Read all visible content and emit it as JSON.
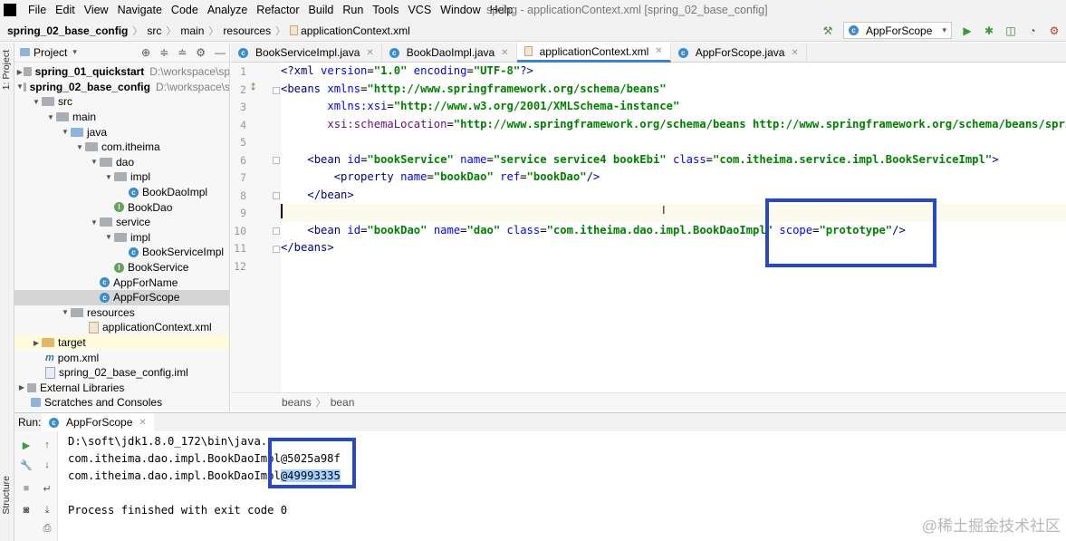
{
  "menubar": {
    "items": [
      "File",
      "Edit",
      "View",
      "Navigate",
      "Code",
      "Analyze",
      "Refactor",
      "Build",
      "Run",
      "Tools",
      "VCS",
      "Window",
      "Help"
    ],
    "window_title": "spring - applicationContext.xml [spring_02_base_config]"
  },
  "navbar": {
    "crumbs": [
      "spring_02_base_config",
      "src",
      "main",
      "resources",
      "applicationContext.xml"
    ],
    "run_config": "AppForScope"
  },
  "left_strip": {
    "project_label": "1: Project",
    "structure_label": "Structure"
  },
  "project": {
    "title": "Project",
    "tree": [
      {
        "label": "spring_01_quickstart",
        "path": "D:\\workspace\\sp"
      },
      {
        "label": "spring_02_base_config",
        "path": "D:\\workspace\\s"
      },
      {
        "label": "src"
      },
      {
        "label": "main"
      },
      {
        "label": "java"
      },
      {
        "label": "com.itheima"
      },
      {
        "label": "dao"
      },
      {
        "label": "impl"
      },
      {
        "label": "BookDaoImpl"
      },
      {
        "label": "BookDao"
      },
      {
        "label": "service"
      },
      {
        "label": "impl"
      },
      {
        "label": "BookServiceImpl"
      },
      {
        "label": "BookService"
      },
      {
        "label": "AppForName"
      },
      {
        "label": "AppForScope"
      },
      {
        "label": "resources"
      },
      {
        "label": "applicationContext.xml"
      },
      {
        "label": "target"
      },
      {
        "label": "pom.xml"
      },
      {
        "label": "spring_02_base_config.iml"
      },
      {
        "label": "External Libraries"
      },
      {
        "label": "Scratches and Consoles"
      }
    ]
  },
  "editor": {
    "tabs": [
      "BookServiceImpl.java",
      "BookDaoImpl.java",
      "applicationContext.xml",
      "AppForScope.java"
    ],
    "active_tab": "applicationContext.xml",
    "line_numbers": [
      "1",
      "2",
      "3",
      "4",
      "5",
      "6",
      "7",
      "8",
      "9",
      "10",
      "11",
      "12"
    ],
    "code": {
      "l1": [
        "<?xml ",
        "version",
        "=",
        "\"1.0\"",
        " ",
        "encoding",
        "=",
        "\"UTF-8\"",
        "?>"
      ],
      "l2": [
        "<beans ",
        "xmlns",
        "=",
        "\"http://www.springframework.org/schema/beans\""
      ],
      "l3": [
        "       ",
        "xmlns:xsi",
        "=",
        "\"http://www.w3.org/2001/XMLSchema-instance\""
      ],
      "l4": [
        "       ",
        "xsi:schemaLocation",
        "=",
        "\"http://www.springframework.org/schema/beans http://www.springframework.org/schema/beans/spri"
      ],
      "l6": [
        "    ",
        "<bean ",
        "id",
        "=",
        "\"bookService\"",
        " ",
        "name",
        "=",
        "\"service service4 bookEbi\"",
        " ",
        "class",
        "=",
        "\"com.itheima.service.impl.BookServiceImpl\"",
        ">"
      ],
      "l7": [
        "        ",
        "<property ",
        "name",
        "=",
        "\"bookDao\"",
        " ",
        "ref",
        "=",
        "\"bookDao\"",
        "/>"
      ],
      "l8": [
        "    ",
        "</bean>"
      ],
      "l10": [
        "    ",
        "<bean ",
        "id",
        "=",
        "\"bookDao\"",
        " ",
        "name",
        "=",
        "\"dao\"",
        " ",
        "class",
        "=",
        "\"com.itheima.dao.impl.BookDaoImpl\"",
        " ",
        "scope",
        "=",
        "\"prototype\"",
        "/>"
      ],
      "l11": [
        "</beans>"
      ]
    },
    "breadcrumb": [
      "beans",
      "bean"
    ]
  },
  "run": {
    "label": "Run:",
    "tab": "AppForScope",
    "console": {
      "line1": "D:\\soft\\jdk1.8.0_172\\bin\\java.",
      "line2_prefix": "com.itheima.dao.impl.BookDaoImpl",
      "line2_hash": "@5025a98f",
      "line3_prefix": "com.itheima.dao.impl.BookDaoImpl",
      "line3_hash": "@49993335",
      "line4": "Process finished with exit code 0"
    }
  },
  "watermark": "@稀土掘金技术社区",
  "colors": {
    "highlight_box": "#2948c8",
    "active_tab_underline": "#4083c9"
  }
}
